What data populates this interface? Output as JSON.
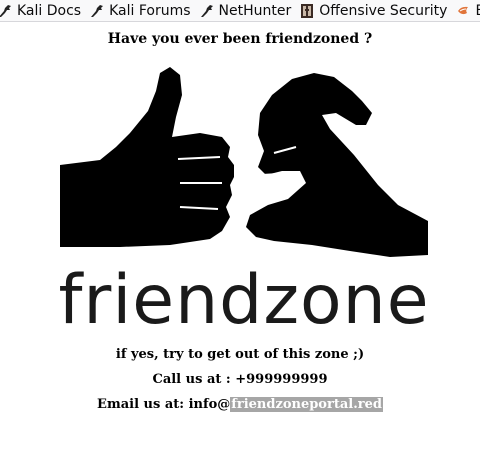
{
  "bookmarks": [
    {
      "label": "Kali Docs",
      "icon": "kali-dragon-icon"
    },
    {
      "label": "Kali Forums",
      "icon": "kali-dragon-icon"
    },
    {
      "label": "NetHunter",
      "icon": "kali-dragon-icon"
    },
    {
      "label": "Offensive Security",
      "icon": "offsec-logo-icon"
    },
    {
      "label": "Ex",
      "icon": "exploit-db-icon"
    }
  ],
  "page": {
    "question": "Have you ever been friendzoned ?",
    "image_text": "friendzone",
    "line1": "if yes, try to get out of this zone ;)",
    "line2": "Call us at : +999999999",
    "email_prefix": "Email us at: info@",
    "email_domain": "friendzoneportal.red"
  },
  "colors": {
    "bar_bg": "#f9f9fa",
    "email_highlight": "#a6a6a6",
    "text": "#000000"
  }
}
